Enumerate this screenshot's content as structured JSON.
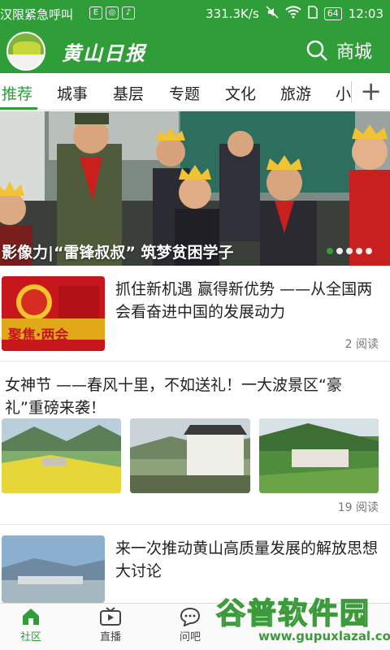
{
  "status_bar": {
    "carrier_text": "汉限紧急呼叫",
    "speed": "331.3K/s",
    "battery": "64",
    "time": "12:03",
    "app_icons": [
      "E",
      "◎",
      "♪"
    ]
  },
  "header": {
    "brand": "黄山日报",
    "shop_label": "商城",
    "color": "#2f9e38"
  },
  "tabs": [
    "推荐",
    "城事",
    "基层",
    "专题",
    "文化",
    "旅游",
    "小"
  ],
  "active_tab": "推荐",
  "banner": {
    "caption": "影像力|“雷锋叔叔” 筑梦贫困学子",
    "dots_count": 5,
    "active_dot_index": 0
  },
  "news": [
    {
      "title": "抓住新机遇 赢得新优势 ——从全国两会看奋进中国的发展动力",
      "reads": "2 阅读",
      "thumb_text": "聚焦·两会"
    },
    {
      "title": "女神节 ——春风十里，不如送礼！一大波景区“豪礼”重磅来袭！",
      "reads": "19 阅读"
    },
    {
      "title": "来一次推动黄山高质量发展的解放思想大讨论",
      "reads": ""
    }
  ],
  "bottom_nav": [
    {
      "label": "社区",
      "icon": "home-icon",
      "active": true
    },
    {
      "label": "直播",
      "icon": "tv-icon",
      "active": false
    },
    {
      "label": "问吧",
      "icon": "chat-icon",
      "active": false
    }
  ],
  "watermark": {
    "text": "谷普软件园",
    "url": "www.gupuxlazal.com"
  }
}
